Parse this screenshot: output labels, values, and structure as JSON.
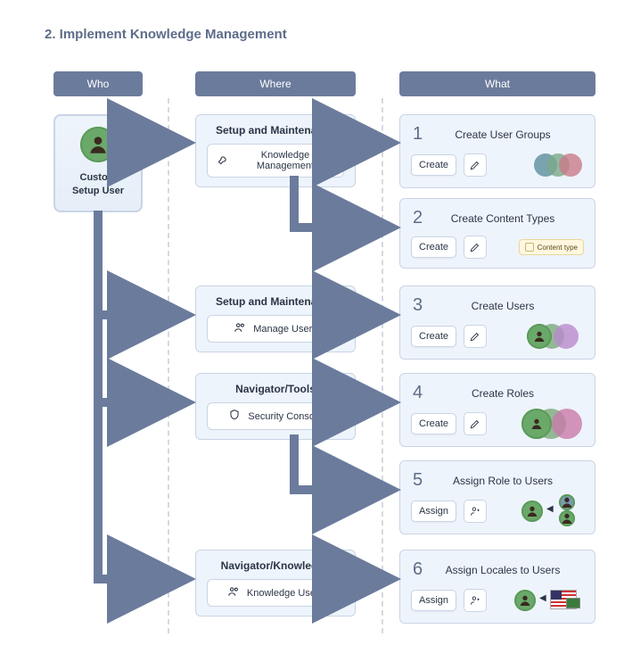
{
  "title": "2.  Implement Knowledge Management",
  "columns": {
    "who": "Who",
    "where": "Where",
    "what": "What"
  },
  "who": {
    "label_l1": "Custom",
    "label_l2": "Setup User"
  },
  "where": {
    "w1": {
      "title": "Setup and Maintenance",
      "chip": "Knowledge Management"
    },
    "w2": {
      "title": "Setup and Maintenance",
      "chip": "Manage Users"
    },
    "w3": {
      "title": "Navigator/Tools",
      "chip": "Security Console"
    },
    "w4": {
      "title": "Navigator/Knowledge",
      "chip": "Knowledge Users"
    }
  },
  "what": {
    "s1": {
      "num": "1",
      "title": "Create User Groups",
      "action": "Create"
    },
    "s2": {
      "num": "2",
      "title": "Create Content Types",
      "action": "Create",
      "tag": "Content type"
    },
    "s3": {
      "num": "3",
      "title": "Create Users",
      "action": "Create"
    },
    "s4": {
      "num": "4",
      "title": "Create Roles",
      "action": "Create"
    },
    "s5": {
      "num": "5",
      "title": "Assign Role to Users",
      "action": "Assign"
    },
    "s6": {
      "num": "6",
      "title": "Assign Locales to Users",
      "action": "Assign"
    }
  }
}
